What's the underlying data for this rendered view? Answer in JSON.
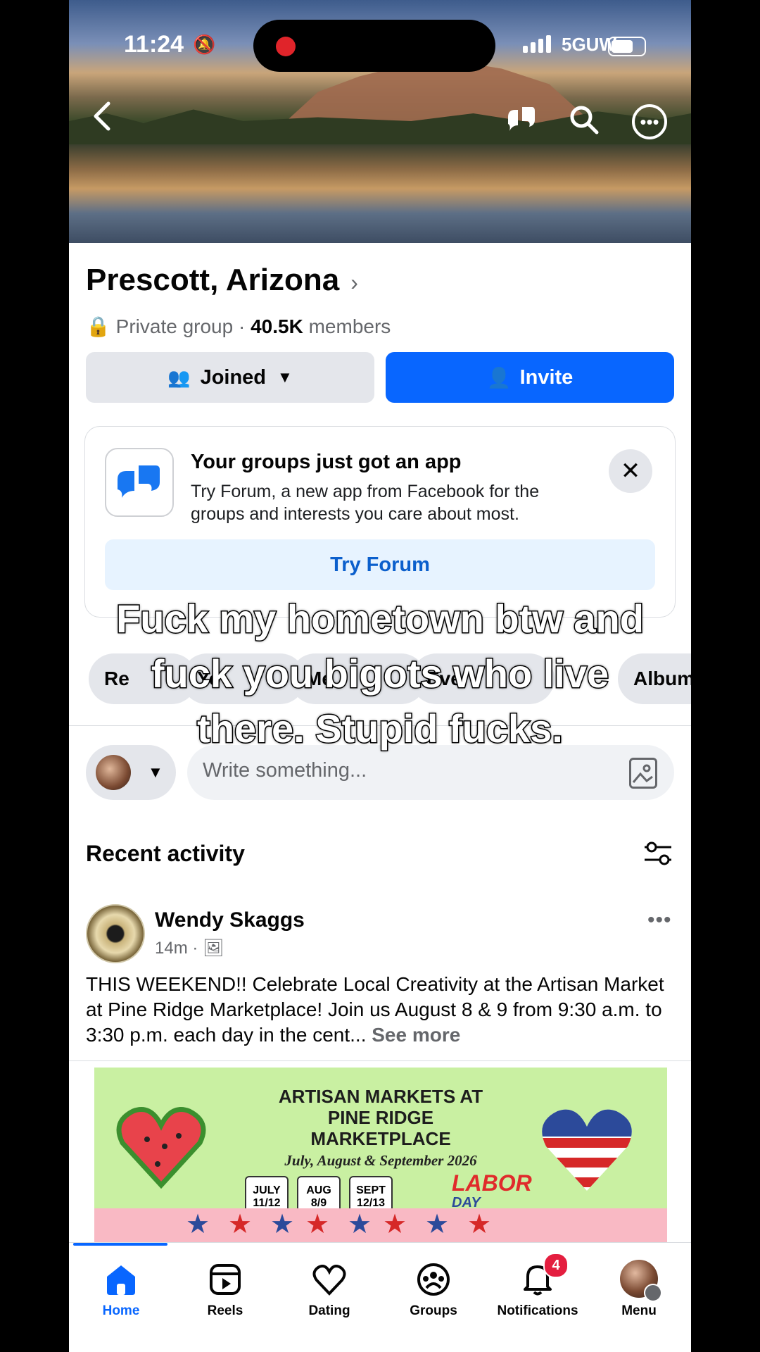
{
  "status_bar": {
    "time": "11:24",
    "network": "5GUW"
  },
  "cover": {
    "icons": [
      "back-arrow-icon",
      "forum-icon",
      "search-icon",
      "more-icon"
    ]
  },
  "group": {
    "name": "Prescott, Arizona",
    "privacy": "Private group",
    "member_count": "40.5K",
    "members_label": "members"
  },
  "actions": {
    "joined_label": "Joined",
    "invite_label": "Invite"
  },
  "promo": {
    "title": "Your groups just got an app",
    "body": "Try Forum, a new app from Facebook for the groups and interests you care about most.",
    "button_label": "Try Forum"
  },
  "chips": [
    "Re",
    "Yo",
    "Me",
    "Eve",
    "Albums"
  ],
  "composer": {
    "placeholder": "Write something..."
  },
  "recent": {
    "title": "Recent activity"
  },
  "post": {
    "author": "Wendy Skaggs",
    "time": "14m",
    "text": "THIS WEEKEND!! Celebrate Local Creativity at the Artisan Market at Pine Ridge Marketplace! Join us August 8 & 9 from 9:30 a.m. to 3:30 p.m. each day in the cent...",
    "see_more": "See more",
    "image": {
      "title_lines": [
        "ARTISAN MARKETS AT",
        "PINE RIDGE",
        "MARKETPLACE"
      ],
      "subtitle": "July, August & September 2026",
      "dates": [
        {
          "month": "JULY",
          "days": "11/12"
        },
        {
          "month": "AUG",
          "days": "8/9"
        },
        {
          "month": "SEPT",
          "days": "12/13"
        }
      ],
      "labor": "LABOR",
      "day": "DAY"
    }
  },
  "caption": {
    "lines": [
      "Fuck my hometown btw and",
      "fuck you bigots who live",
      "there. Stupid fucks."
    ]
  },
  "tabs": [
    {
      "label": "Home",
      "icon": "home-icon"
    },
    {
      "label": "Reels",
      "icon": "reels-icon"
    },
    {
      "label": "Dating",
      "icon": "heart-icon"
    },
    {
      "label": "Groups",
      "icon": "groups-icon"
    },
    {
      "label": "Notifications",
      "icon": "bell-icon",
      "badge": "4"
    },
    {
      "label": "Menu",
      "icon": "avatar"
    }
  ],
  "colors": {
    "accent": "#0866ff",
    "badge": "#e41e3f"
  }
}
